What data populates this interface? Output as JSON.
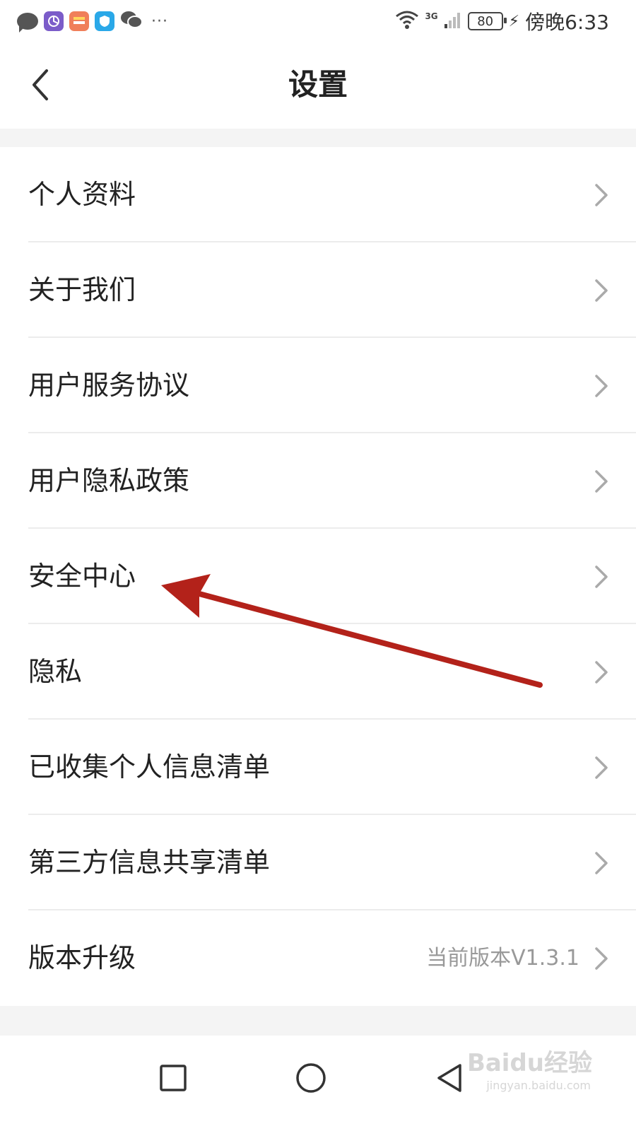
{
  "status_bar": {
    "time": "傍晚6:33",
    "battery": "80",
    "network": "3G",
    "more": "···",
    "icons": [
      "message-icon",
      "gallery-icon",
      "app-icon",
      "shield-app-icon",
      "wechat-icon"
    ]
  },
  "header": {
    "title": "设置",
    "back_icon": "chevron-left-icon"
  },
  "settings": {
    "items": [
      {
        "label": "个人资料",
        "value": ""
      },
      {
        "label": "关于我们",
        "value": ""
      },
      {
        "label": "用户服务协议",
        "value": ""
      },
      {
        "label": "用户隐私政策",
        "value": ""
      },
      {
        "label": "安全中心",
        "value": ""
      },
      {
        "label": "隐私",
        "value": ""
      },
      {
        "label": "已收集个人信息清单",
        "value": ""
      },
      {
        "label": "第三方信息共享清单",
        "value": ""
      },
      {
        "label": "版本升级",
        "value": "当前版本V1.3.1"
      }
    ]
  },
  "annotation": {
    "color": "#b3221a",
    "target": "安全中心"
  },
  "nav_bar": {
    "buttons": [
      "recent-apps-icon",
      "home-icon",
      "back-triangle-icon"
    ]
  },
  "watermark": {
    "text": "Baidu经验",
    "sub": "jingyan.baidu.com"
  },
  "colors": {
    "text": "#222222",
    "secondary": "#999999",
    "divider": "#ececec",
    "background_gap": "#f4f4f4"
  }
}
